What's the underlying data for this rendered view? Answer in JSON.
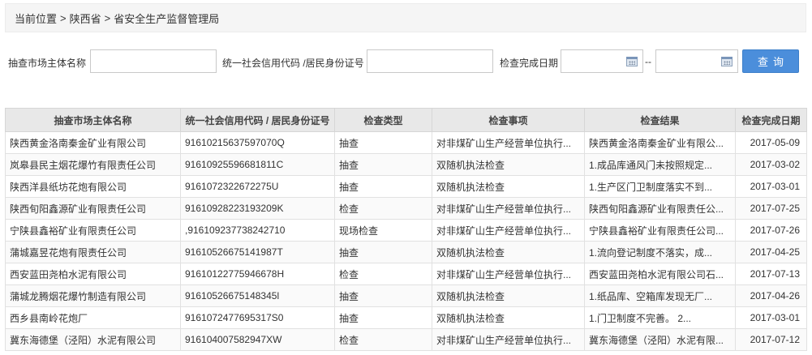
{
  "breadcrumb": {
    "current": "当前位置",
    "sep1": ">",
    "level1": "陕西省",
    "sep2": ">",
    "level2": "省安全生产监督管理局"
  },
  "search": {
    "entity_label": "抽查市场主体名称",
    "entity_value": "",
    "code_label": "统一社会信用代码 /居民身份证号",
    "code_value": "",
    "date_label": "检查完成日期",
    "date_from": "",
    "date_sep": "--",
    "date_to": "",
    "button_label": "查询"
  },
  "table": {
    "headers": [
      "抽查市场主体名称",
      "统一社会信用代码 / 居民身份证号",
      "检查类型",
      "检查事项",
      "检查结果",
      "检查完成日期"
    ],
    "rows": [
      [
        "陕西黄金洛南秦金矿业有限公司",
        "91610215637597070Q",
        "抽查",
        "对非煤矿山生产经营单位执行...",
        "陕西黄金洛南秦金矿业有限公...",
        "2017-05-09"
      ],
      [
        "岚皋县民主烟花爆竹有限责任公司",
        "91610925596681811C",
        "抽查",
        "双随机执法检查",
        "1.成品库通风门未按照规定...",
        "2017-03-02"
      ],
      [
        "陕西洋县纸坊花炮有限公司",
        "9161072322672275U",
        "抽查",
        "双随机执法检查",
        "1.生产区门卫制度落实不到...",
        "2017-03-01"
      ],
      [
        "陕西旬阳鑫源矿业有限责任公司",
        "91610928223193209K",
        "检查",
        "对非煤矿山生产经营单位执行...",
        "陕西旬阳鑫源矿业有限责任公...",
        "2017-07-25"
      ],
      [
        "宁陕县鑫裕矿业有限责任公司",
        ",916109237738242710",
        "现场检查",
        "对非煤矿山生产经营单位执行...",
        "宁陕县鑫裕矿业有限责任公司...",
        "2017-07-26"
      ],
      [
        "蒲城嘉昱花炮有限责任公司",
        "91610526675141987T",
        "抽查",
        "双随机执法检查",
        "1.流向登记制度不落实，成...",
        "2017-04-25"
      ],
      [
        "西安蓝田尧柏水泥有限公司",
        "91610122775946678H",
        "检查",
        "对非煤矿山生产经营单位执行...",
        "西安蓝田尧柏水泥有限公司石...",
        "2017-07-13"
      ],
      [
        "蒲城龙腾烟花爆竹制造有限公司",
        "91610526675148345l",
        "抽查",
        "双随机执法检查",
        "1.纸品库、空箱库发现无厂...",
        "2017-04-26"
      ],
      [
        "西乡县南岭花炮厂",
        "9161072477695317S0",
        "抽查",
        "双随机执法检查",
        "1.门卫制度不完善。 2...",
        "2017-03-01"
      ],
      [
        "冀东海德堡（泾阳）水泥有限公司",
        "916104007582947XW",
        "检查",
        "对非煤矿山生产经营单位执行...",
        "冀东海德堡（泾阳）水泥有限...",
        "2017-07-12"
      ]
    ]
  },
  "colors": {
    "button": "#4b8edb",
    "header_bg": "#e8e8e8",
    "breadcrumb_bg": "#f5f5f5"
  },
  "icons": [
    "calendar-icon"
  ]
}
